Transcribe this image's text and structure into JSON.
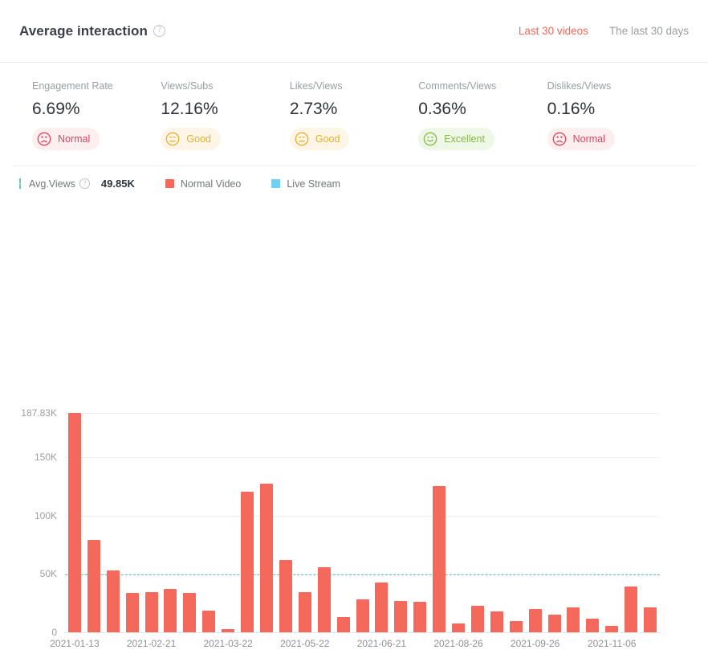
{
  "header": {
    "title": "Average interaction",
    "help_icon": "question-circle-icon",
    "tabs": [
      {
        "label": "Last 30 videos",
        "active": true
      },
      {
        "label": "The last 30 days",
        "active": false
      }
    ]
  },
  "metrics": [
    {
      "label": "Engagement Rate",
      "value": "6.69%",
      "badge": "Normal",
      "badge_state": "normal",
      "face": "frown-face-icon"
    },
    {
      "label": "Views/Subs",
      "value": "12.16%",
      "badge": "Good",
      "badge_state": "good",
      "face": "neutral-face-icon"
    },
    {
      "label": "Likes/Views",
      "value": "2.73%",
      "badge": "Good",
      "badge_state": "good",
      "face": "neutral-face-icon"
    },
    {
      "label": "Comments/Views",
      "value": "0.36%",
      "badge": "Excellent",
      "badge_state": "excellent",
      "face": "smile-face-icon"
    },
    {
      "label": "Dislikes/Views",
      "value": "0.16%",
      "badge": "Normal",
      "badge_state": "normal",
      "face": "frown-face-icon"
    }
  ],
  "legend": {
    "avg_label": "Avg.Views",
    "avg_help_icon": "question-circle-icon",
    "avg_value": "49.85K",
    "items": [
      {
        "label": "Normal Video",
        "color": "#f4695c"
      },
      {
        "label": "Live Stream",
        "color": "#6fd0f2"
      }
    ]
  },
  "colors": {
    "accent": "#f0695a",
    "bar_normal": "#f4695c",
    "bar_live": "#6fd0f2",
    "avg_line": "#5fc3bb",
    "normal_badge": "#e0435c",
    "good_badge": "#e8b02a",
    "excellent_badge": "#83bb45"
  },
  "chart_data": {
    "type": "bar",
    "title": "",
    "xlabel": "",
    "ylabel": "",
    "ylim": [
      0,
      187830
    ],
    "grid": true,
    "legend_position": "top-left",
    "ytick_labels": [
      "187.83K",
      "150K",
      "100K",
      "50K",
      "0"
    ],
    "ytick_values": [
      187830,
      150000,
      100000,
      50000,
      0
    ],
    "xtick_labels": [
      "2021-01-13",
      "2021-02-21",
      "2021-03-22",
      "2021-05-22",
      "2021-06-21",
      "2021-08-26",
      "2021-09-26",
      "2021-11-06"
    ],
    "xtick_indices": [
      0,
      4,
      8,
      12,
      16,
      20,
      24,
      28
    ],
    "average_line": {
      "label": "Avg.Views",
      "value": 49850,
      "display": "49.85K",
      "color": "#5fc3bb",
      "style": "dashed"
    },
    "series": [
      {
        "name": "Normal Video",
        "color": "#f4695c"
      },
      {
        "name": "Live Stream",
        "color": "#6fd0f2"
      }
    ],
    "categories": [
      "2021-01-13",
      "",
      "",
      "",
      "2021-02-21",
      "",
      "",
      "",
      "2021-03-22",
      "",
      "",
      "",
      "2021-05-22",
      "",
      "",
      "",
      "2021-06-21",
      "",
      "",
      "",
      "2021-08-26",
      "",
      "",
      "",
      "2021-09-26",
      "",
      "",
      "",
      "2021-11-06",
      ""
    ],
    "values": [
      187830,
      79000,
      53000,
      34000,
      34500,
      37000,
      33500,
      18500,
      2500,
      120500,
      127500,
      62000,
      34500,
      55500,
      13000,
      28000,
      43000,
      26500,
      26000,
      125500,
      7500,
      22500,
      18000,
      9500,
      20000,
      15000,
      21500,
      12000,
      5500,
      39500,
      21000
    ],
    "bar_types": [
      "normal",
      "normal",
      "normal",
      "normal",
      "normal",
      "normal",
      "normal",
      "normal",
      "normal",
      "normal",
      "normal",
      "normal",
      "normal",
      "normal",
      "normal",
      "normal",
      "normal",
      "normal",
      "normal",
      "normal",
      "normal",
      "normal",
      "normal",
      "normal",
      "normal",
      "normal",
      "normal",
      "normal",
      "normal",
      "normal",
      "normal"
    ]
  }
}
